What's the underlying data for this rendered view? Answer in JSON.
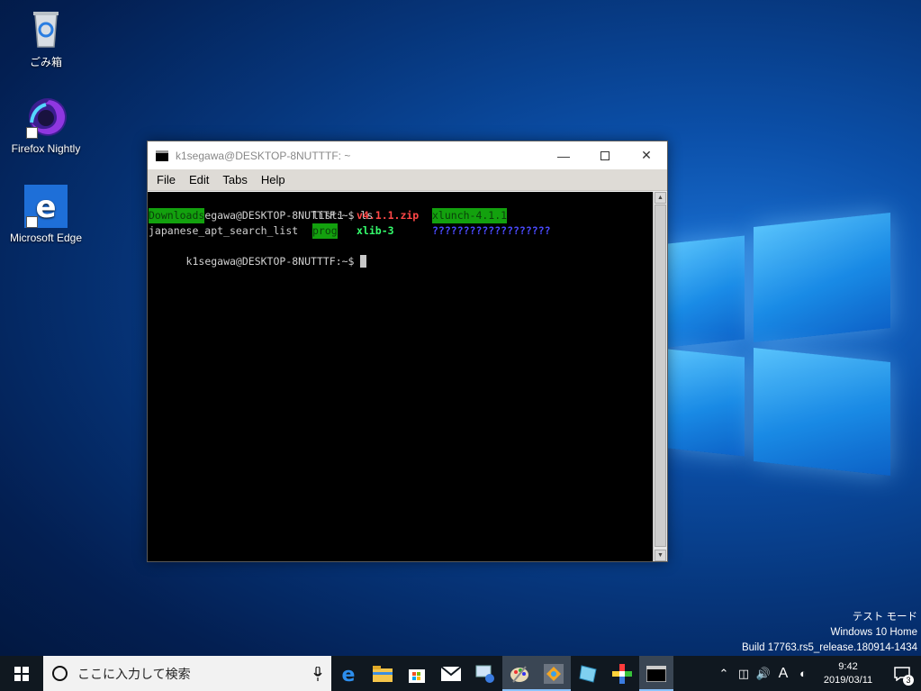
{
  "desktop": {
    "icons": [
      {
        "label": "ごみ箱",
        "icon": "recycle-bin-icon"
      },
      {
        "label": "Firefox Nightly",
        "icon": "firefox-nightly-icon"
      },
      {
        "label": "Microsoft Edge",
        "icon": "edge-icon"
      }
    ]
  },
  "terminal": {
    "title": "k1segawa@DESKTOP-8NUTTTF: ~",
    "menu": [
      "File",
      "Edit",
      "Tabs",
      "Help"
    ],
    "prompt": "k1segawa@DESKTOP-8NUTTTF:~$",
    "command": " ls",
    "ls": {
      "downloads": "Downloads",
      "list1": "list1",
      "zip": "v4.1.1.zip",
      "xlunch": "xlunch-4.1.1",
      "apt_list": "japanese_apt_search_list",
      "prog": "prog",
      "xlib": "xlib-3",
      "garbled": "???????????????????"
    },
    "colors": {
      "dir_bg": "#13a10e",
      "archive": "#ff4747",
      "dir": "#35ff6d",
      "unknown": "#4a4aff"
    }
  },
  "watermark": {
    "line1": "テスト モード",
    "line2": "Windows 10 Home",
    "line3": "Build 17763.rs5_release.180914-1434"
  },
  "taskbar": {
    "search_placeholder": "ここに入力して検索",
    "apps": [
      "edge-icon",
      "file-explorer-icon",
      "store-icon",
      "mail-icon",
      "network-app-icon",
      "paint-icon",
      "xming-icon",
      "notepad-icon",
      "color-picker-icon",
      "terminal-icon"
    ],
    "ime_label": "A",
    "time": "9:42",
    "date": "2019/03/11",
    "notification_count": "3"
  }
}
